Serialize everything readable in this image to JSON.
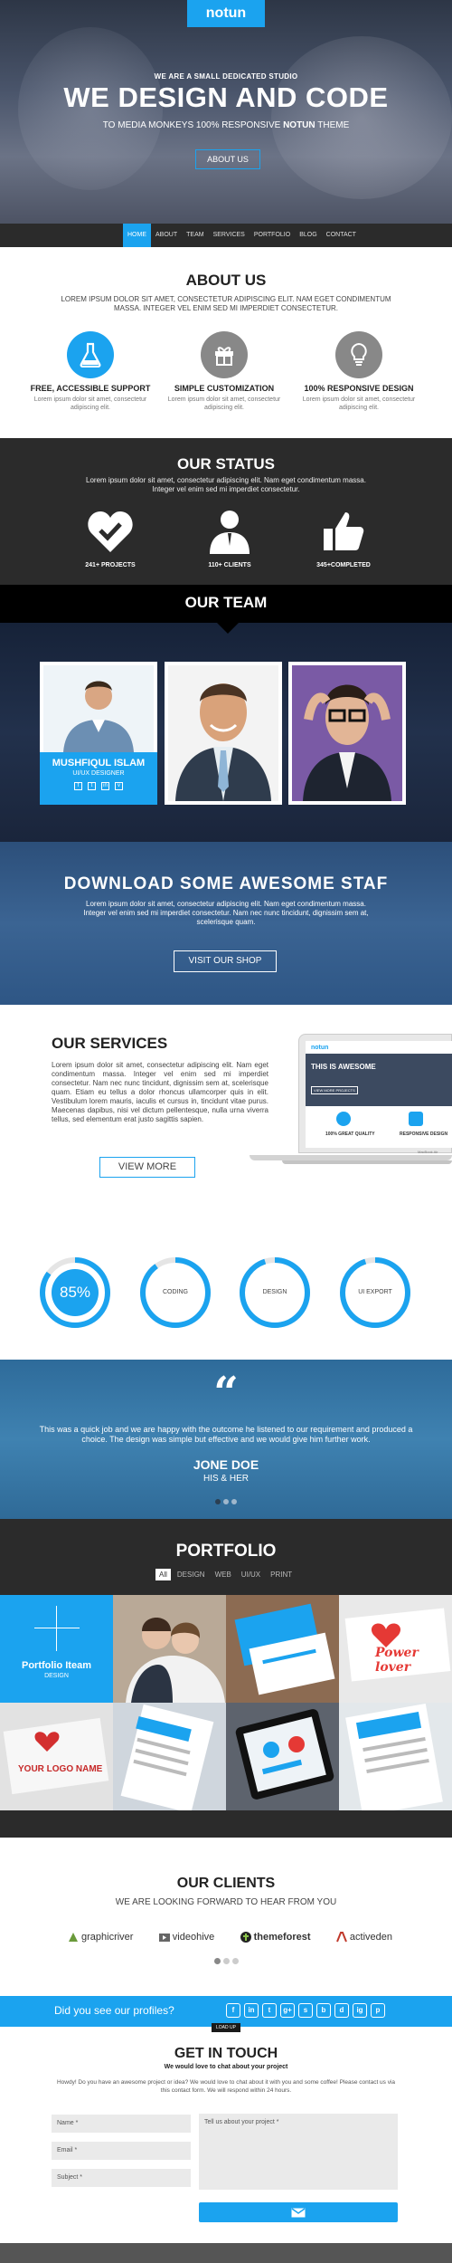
{
  "header": {
    "logo": "notun",
    "tagline_small": "WE ARE A SMALL DEDICATED STUDIO",
    "title": "WE DESIGN AND CODE",
    "subtitle_pre": "TO MEDIA MONKEYS 100% RESPONSIVE ",
    "subtitle_brand": "NOTUN",
    "subtitle_post": " THEME",
    "cta": "ABOUT US"
  },
  "nav": {
    "items": [
      "HOME",
      "ABOUT",
      "TEAM",
      "SERVICES",
      "PORTFOLIO",
      "BLOG",
      "CONTACT"
    ],
    "active": "HOME"
  },
  "about": {
    "title": "ABOUT US",
    "text": "LOREM IPSUM DOLOR SIT AMET, CONSECTETUR ADIPISCING ELIT. NAM EGET CONDIMENTUM MASSA. INTEGER VEL ENIM SED MI IMPERDIET CONSECTETUR.",
    "features": [
      {
        "icon": "flask-icon",
        "title": "FREE, ACCESSIBLE SUPPORT",
        "desc": "Lorem ipsum dolor sit amet, consectetur adipiscing elit."
      },
      {
        "icon": "gift-icon",
        "title": "SIMPLE CUSTOMIZATION",
        "desc": "Lorem ipsum dolor sit amet, consectetur adipiscing elit."
      },
      {
        "icon": "lightbulb-icon",
        "title": "100% RESPONSIVE DESIGN",
        "desc": "Lorem ipsum dolor sit amet, consectetur adipiscing elit."
      }
    ],
    "colors": {
      "accent": "#1ba3ef",
      "neutral": "#888888"
    }
  },
  "status": {
    "title": "OUR STATUS",
    "text": "Lorem ipsum dolor sit amet, consectetur adipiscing elit. Nam eget condimentum massa. Integer vel enim sed mi imperdiet consectetur.",
    "stats": [
      {
        "icon": "heart-check-icon",
        "label": "241+ PROJECTS"
      },
      {
        "icon": "person-icon",
        "label": "110+ CLIENTS"
      },
      {
        "icon": "thumbs-up-icon",
        "label": "345+COMPLETED"
      }
    ]
  },
  "team": {
    "title": "OUR TEAM",
    "featured_name": "MUSHFIQUL ISLAM",
    "featured_role": "UI/UX DESIGNER",
    "social": [
      "f",
      "in",
      "t",
      "v"
    ]
  },
  "download": {
    "title": "DOWNLOAD SOME AWESOME STAF",
    "text": "Lorem ipsum dolor sit amet, consectetur adipiscing elit. Nam eget condimentum massa. Integer vel enim sed mi imperdiet consectetur. Nam nec nunc tincidunt, dignissim sem at, scelerisque quam.",
    "cta": "VISIT OUR SHOP"
  },
  "services": {
    "title": "OUR SERVICES",
    "text": "Lorem ipsum dolor sit amet, consectetur adipiscing elit. Nam eget condimentum massa. Integer vel enim sed mi imperdiet consectetur. Nam nec nunc tincidunt, dignissim sem at, scelerisque quam. Etiam eu tellus a dolor rhoncus ullamcorper quis in elit. Vestibulum lorem mauris, iaculis et cursus in, tincidunt vitae purus. Maecenas dapibus, nisi vel dictum pellentesque, nulla urna viverra tellus, sed elementum erat justo sagittis sapien.",
    "cta": "VIEW MORE",
    "laptop": {
      "brand": "notun",
      "headline": "THIS IS AWESOME",
      "button": "VIEW MORE PROJECTS",
      "features": [
        "100% GREAT QUALITY",
        "RESPONSIVE DESIGN"
      ],
      "model": "MacBook Air"
    },
    "skills": [
      {
        "label": "85%",
        "value": 0.85,
        "highlight": true
      },
      {
        "label": "CODING",
        "value": 0.9,
        "highlight": false
      },
      {
        "label": "DESIGN",
        "value": 0.95,
        "highlight": false
      },
      {
        "label": "UI EXPORT",
        "value": 0.95,
        "highlight": false
      }
    ]
  },
  "testimonial": {
    "quote_mark": "“",
    "text": "This was a quick job and we are happy with the outcome he listened to our requirement and produced a choice. The design was simple but effective and we would give him further work.",
    "name": "JONE DOE",
    "role": "HIS & HER"
  },
  "portfolio": {
    "title": "PORTFOLIO",
    "filters": [
      "All",
      "DESIGN",
      "WEB",
      "UI/UX",
      "PRINT"
    ],
    "active_filter": "All",
    "featured_title": "Portfolio Iteam",
    "featured_sub": "DESIGN",
    "tile_texts": {
      "power_lover": "Power lover",
      "logo": "YOUR LOGO NAME"
    }
  },
  "clients": {
    "title": "OUR CLIENTS",
    "subtitle": "WE ARE LOOKING FORWARD TO HEAR FROM YOU",
    "items": [
      "graphicriver",
      "videohive",
      "themeforest",
      "activeden"
    ]
  },
  "profiles": {
    "text": "Did you see our profiles?",
    "icons": [
      "f",
      "in",
      "t",
      "g+",
      "s",
      "b",
      "d",
      "ig",
      "p"
    ],
    "load_up": "LOAD UP"
  },
  "contact": {
    "title": "GET IN TOUCH",
    "subtitle": "We would love to chat about your project",
    "text": "Howdy! Do you have an awesome project or idea? We would love to chat about it with you and some coffee! Please contact us via this contact form. We will respond within 24 hours.",
    "name_placeholder": "Name *",
    "email_placeholder": "Email *",
    "subject_placeholder": "Subject *",
    "message_placeholder": "Tell us about your project *"
  }
}
